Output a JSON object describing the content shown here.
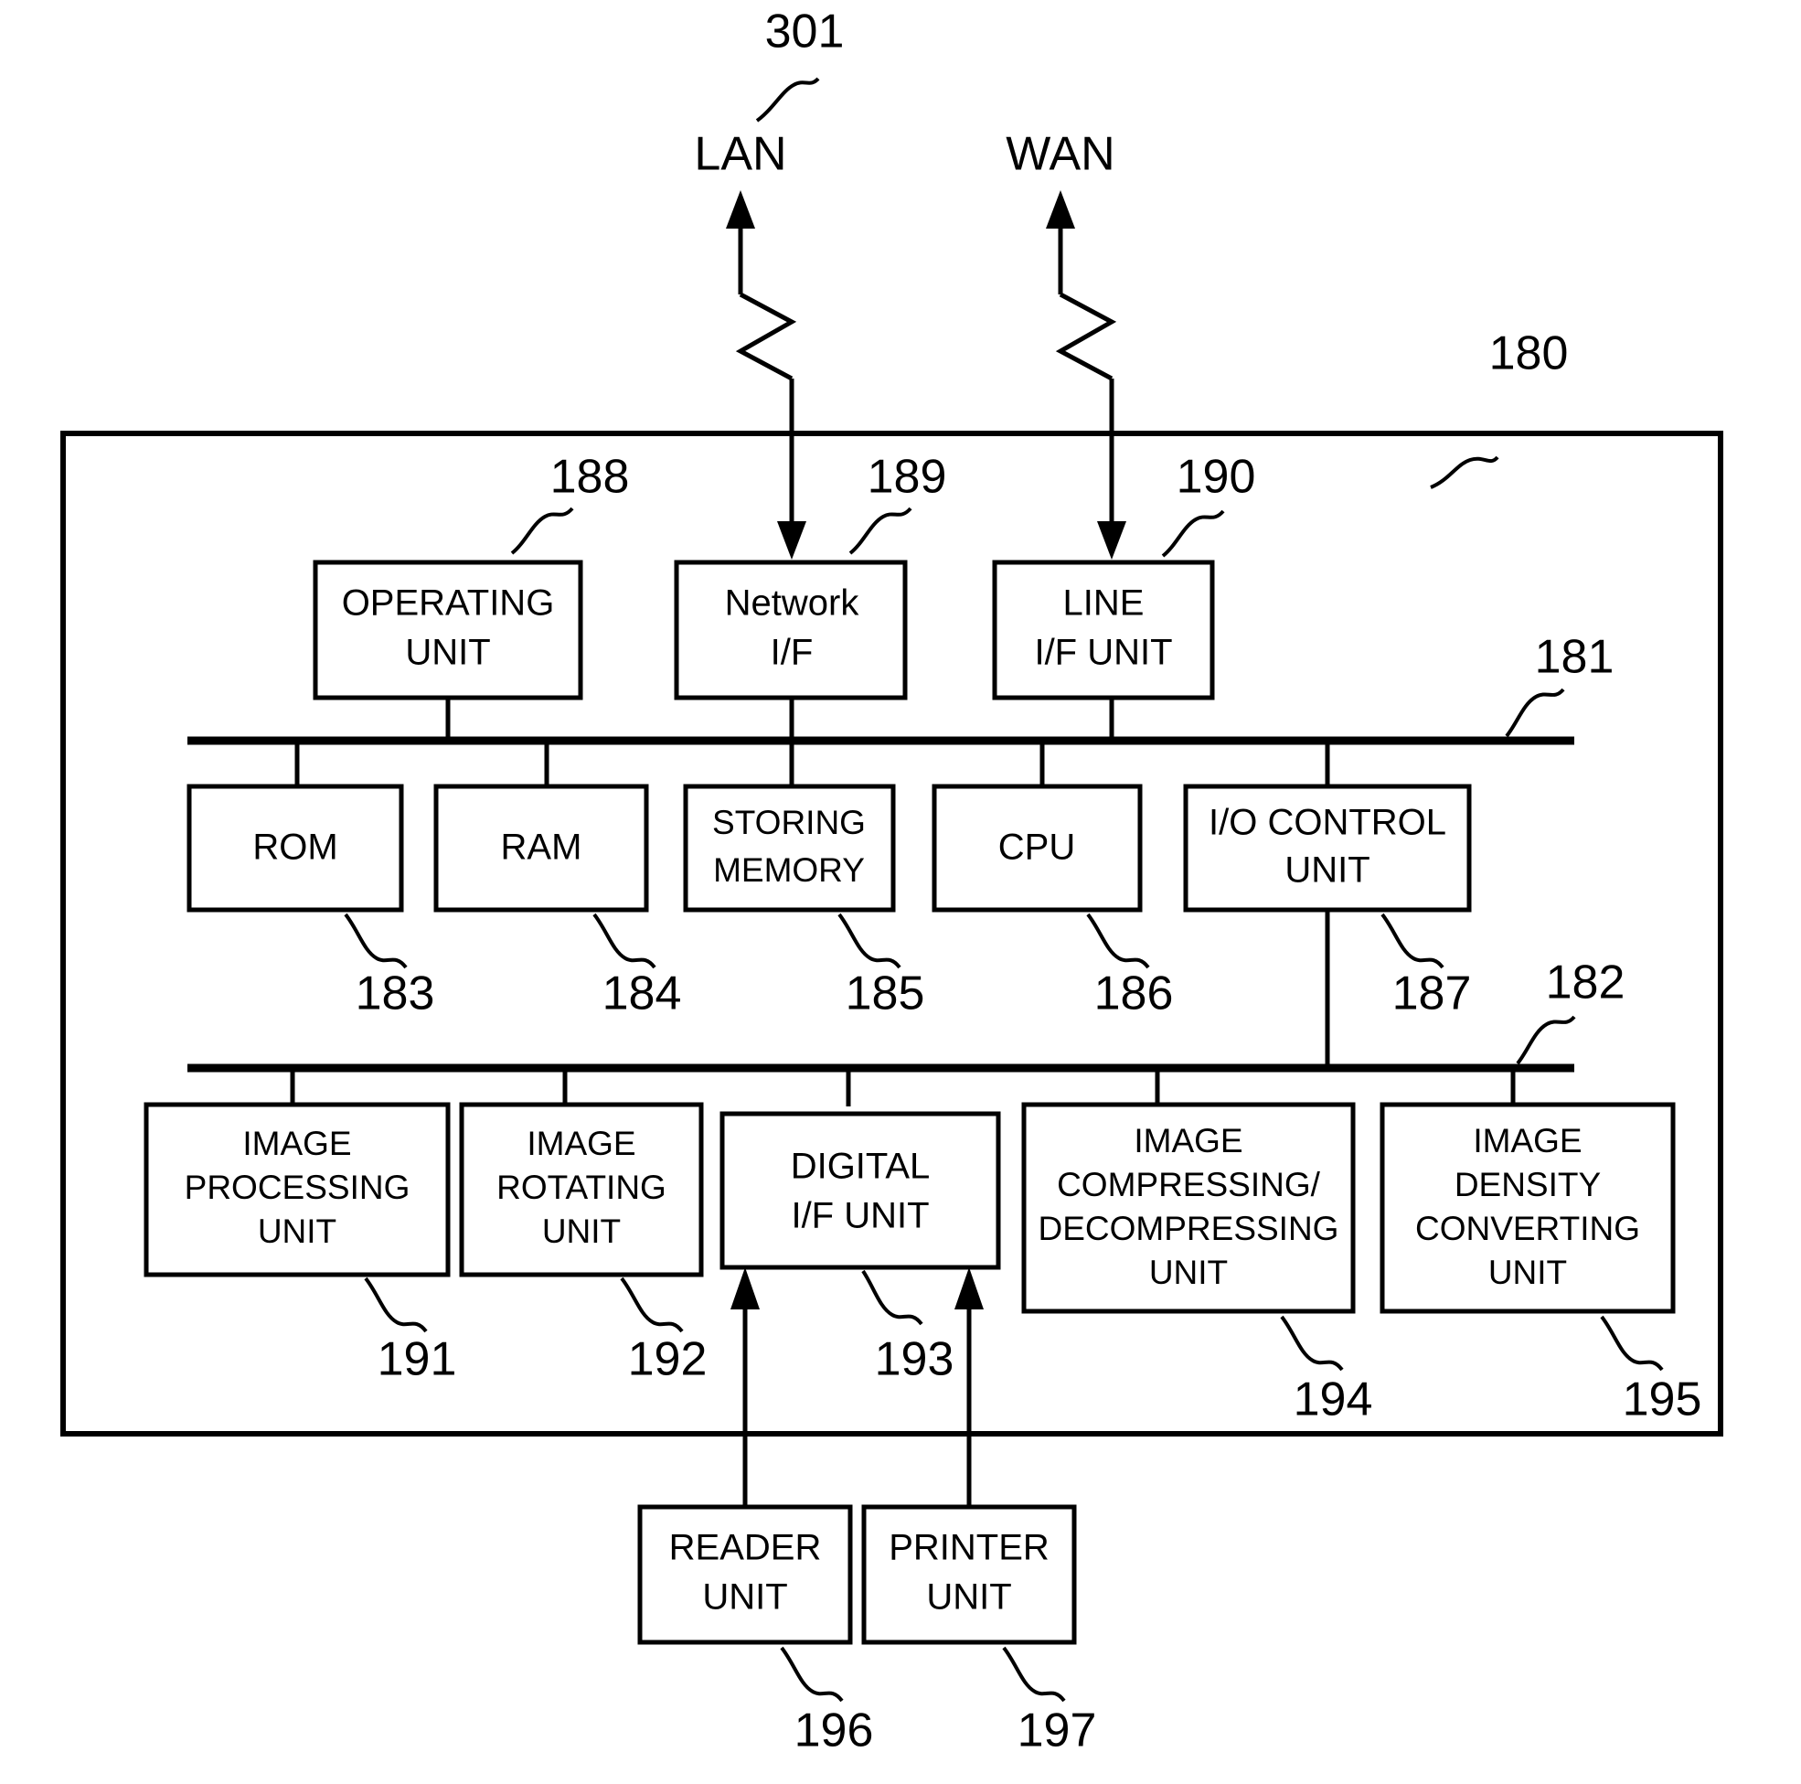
{
  "figure": {
    "enclosure_ref": "180",
    "external_networks": [
      {
        "name": "lan-link",
        "label": "LAN",
        "ref": "301"
      },
      {
        "name": "wan-link",
        "label": "WAN",
        "ref": ""
      }
    ],
    "buses": [
      {
        "name": "system-bus",
        "ref": "181"
      },
      {
        "name": "image-bus",
        "ref": "182"
      }
    ],
    "top_row": [
      {
        "name": "operating-unit",
        "lines": [
          "OPERATING",
          "UNIT"
        ],
        "ref": "188"
      },
      {
        "name": "network-if",
        "lines": [
          "Network",
          "I/F"
        ],
        "ref": "189"
      },
      {
        "name": "line-if-unit",
        "lines": [
          "LINE",
          "I/F UNIT"
        ],
        "ref": "190"
      }
    ],
    "middle_row": [
      {
        "name": "rom",
        "lines": [
          "ROM"
        ],
        "ref": "183"
      },
      {
        "name": "ram",
        "lines": [
          "RAM"
        ],
        "ref": "184"
      },
      {
        "name": "storing-memory",
        "lines": [
          "STORING",
          "MEMORY"
        ],
        "ref": "185"
      },
      {
        "name": "cpu",
        "lines": [
          "CPU"
        ],
        "ref": "186"
      },
      {
        "name": "io-control-unit",
        "lines": [
          "I/O CONTROL",
          "UNIT"
        ],
        "ref": "187"
      }
    ],
    "bottom_row": [
      {
        "name": "image-processing-unit",
        "lines": [
          "IMAGE",
          "PROCESSING",
          "UNIT"
        ],
        "ref": "191"
      },
      {
        "name": "image-rotating-unit",
        "lines": [
          "IMAGE",
          "ROTATING",
          "UNIT"
        ],
        "ref": "192"
      },
      {
        "name": "digital-if-unit",
        "lines": [
          "DIGITAL",
          "I/F UNIT"
        ],
        "ref": "193"
      },
      {
        "name": "image-compressing-decompressing-unit",
        "lines": [
          "IMAGE",
          "COMPRESSING/",
          "DECOMPRESSING",
          "UNIT"
        ],
        "ref": "194"
      },
      {
        "name": "image-density-converting-unit",
        "lines": [
          "IMAGE",
          "DENSITY",
          "CONVERTING",
          "UNIT"
        ],
        "ref": "195"
      }
    ],
    "external_row": [
      {
        "name": "reader-unit",
        "lines": [
          "READER",
          "UNIT"
        ],
        "ref": "196"
      },
      {
        "name": "printer-unit",
        "lines": [
          "PRINTER",
          "UNIT"
        ],
        "ref": "197"
      }
    ],
    "colors": {
      "ink": "#000000",
      "paper": "#ffffff"
    }
  }
}
